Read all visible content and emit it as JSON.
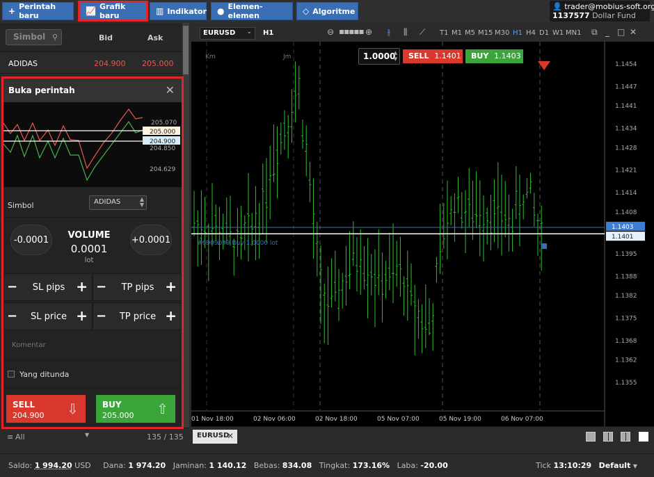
{
  "toolbar": {
    "new_order": "Perintah baru",
    "new_chart": "Grafik baru",
    "indicator": "Indikator",
    "elements": "Elemen-elemen",
    "algorithm": "Algoritme"
  },
  "account": {
    "email": "trader@mobius-soft.org",
    "id": "1137577",
    "fund": "Dollar Fund"
  },
  "watchlist": {
    "search_placeholder": "Simbol",
    "col_bid": "Bid",
    "col_ask": "Ask",
    "rows": [
      {
        "symbol": "ADIDAS",
        "bid": "204.900",
        "ask": "205.000"
      }
    ],
    "filter": "All",
    "count": "135 / 135"
  },
  "order_panel": {
    "title": "Buka perintah",
    "mini_labels": [
      "205.070",
      "205.000",
      "204.900",
      "204.850",
      "204.629"
    ],
    "symbol_label": "Simbol",
    "symbol_value": "ADIDAS",
    "minus": "-0.0001",
    "plus": "+0.0001",
    "volume_label": "VOLUME",
    "volume_value": "0.0001",
    "volume_unit": "lot",
    "sl_pips": "SL pips",
    "tp_pips": "TP pips",
    "sl_price": "SL price",
    "tp_price": "TP price",
    "comment_placeholder": "Komentar",
    "pending_label": "Yang ditunda",
    "sell_label": "SELL",
    "sell_price": "204.900",
    "buy_label": "BUY",
    "buy_price": "205.000"
  },
  "chart": {
    "symbol": "EURUSD",
    "timeframe": "H1",
    "timeframes": [
      "T1",
      "M1",
      "M5",
      "M15",
      "M30",
      "H1",
      "H4",
      "D1",
      "W1",
      "MN1"
    ],
    "active_timeframe": "H1",
    "volume": "1.0000",
    "sell_label": "SELL",
    "sell_price": "1.1401",
    "buy_label": "BUY",
    "buy_price": "1.1403",
    "day_labels": [
      "Km",
      "Jm"
    ],
    "position_label": "#6909099 Buy 1.0000 lot",
    "price_labels": [
      "1.1454",
      "1.1447",
      "1.1441",
      "1.1434",
      "1.1428",
      "1.1421",
      "1.1414",
      "1.1408",
      "1.1403",
      "1.1401",
      "1.1395",
      "1.1388",
      "1.1382",
      "1.1375",
      "1.1368",
      "1.1362",
      "1.1355"
    ],
    "time_labels": [
      "01 Nov 18:00",
      "02 Nov 06:00",
      "02 Nov 18:00",
      "05 Nov 07:00",
      "05 Nov 19:00",
      "06 Nov 07:00"
    ],
    "colors": {
      "bar": "#2fbf2f",
      "sell": "#d9382d",
      "buy": "#3aa63a",
      "accent": "#3a6fb5"
    }
  },
  "tabs": [
    {
      "label": "EURUSD"
    }
  ],
  "status": {
    "saldo_label": "Saldo:",
    "saldo_value": "1 994.20",
    "currency": "USD",
    "dana_label": "Dana:",
    "dana_value": "1 974.20",
    "jaminan_label": "Jaminan:",
    "jaminan_value": "1 140.12",
    "bebas_label": "Bebas:",
    "bebas_value": "834.08",
    "tingkat_label": "Tingkat:",
    "tingkat_value": "173.16%",
    "laba_label": "Laba:",
    "laba_value": "-20.00",
    "tick_label": "Tick",
    "tick_time": "13:10:29",
    "profile": "Default"
  }
}
